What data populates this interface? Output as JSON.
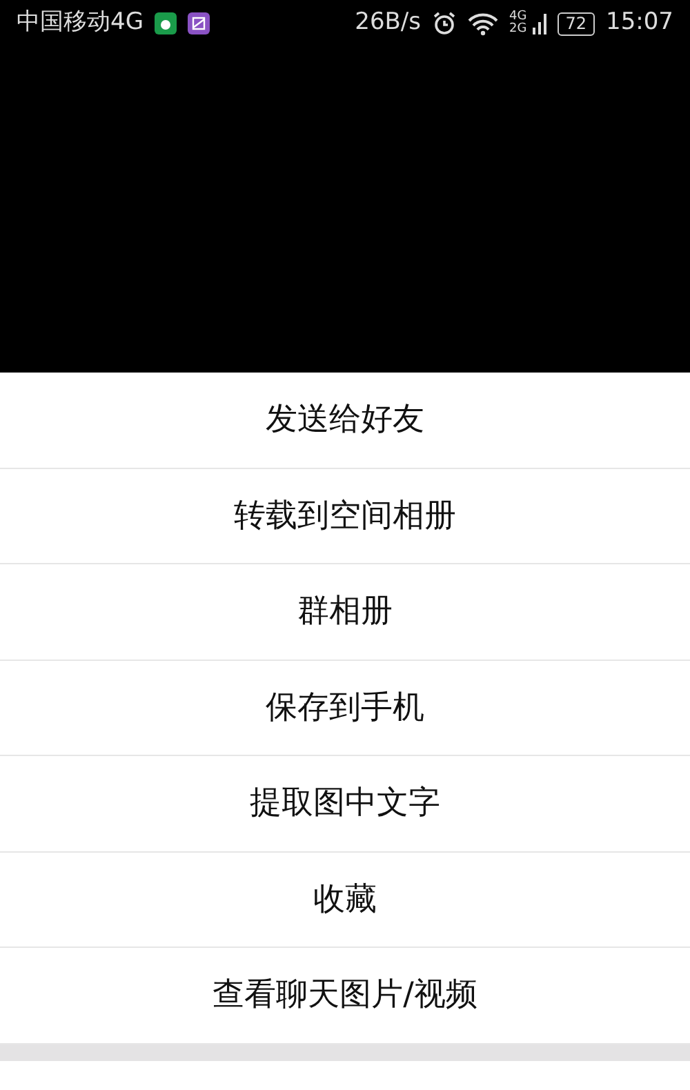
{
  "status_bar": {
    "carrier": "中国移动4G",
    "speed": "26B/s",
    "network_top": "4G",
    "network_bottom": "2G",
    "battery": "72",
    "time": "15:07"
  },
  "menu": {
    "items": [
      {
        "label": "发送给好友"
      },
      {
        "label": "转载到空间相册"
      },
      {
        "label": "群相册"
      },
      {
        "label": "保存到手机"
      },
      {
        "label": "提取图中文字"
      },
      {
        "label": "收藏"
      },
      {
        "label": "查看聊天图片/视频"
      }
    ]
  }
}
